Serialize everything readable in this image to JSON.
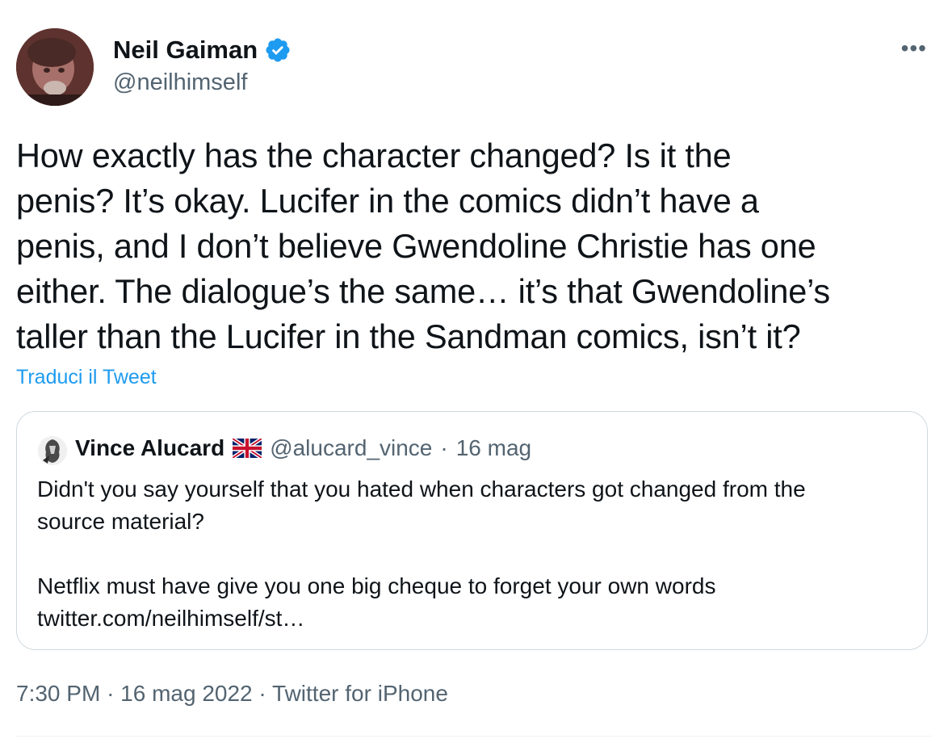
{
  "author": {
    "name": "Neil Gaiman",
    "handle": "@neilhimself",
    "verified_color": "#1d9bf0"
  },
  "more_menu": {
    "label": "•••",
    "icon": "more-horizontal-icon"
  },
  "tweet": {
    "text": "How exactly has the character changed? Is it the\npenis? It’s okay. Lucifer in the comics didn’t have a\npenis, and I don’t believe Gwendoline Christie has one\neither. The dialogue’s the same… it’s that Gwendoline’s\ntaller than the Lucifer in the Sandman comics, isn’t it?",
    "translate_label": "Traduci il Tweet"
  },
  "quoted": {
    "name": "Vince Alucard",
    "flag_icon": "uk-flag-icon",
    "handle": "@alucard_vince",
    "separator": "·",
    "date": "16 mag",
    "text": "Didn't you say yourself that you hated when characters got changed from the\nsource material?\n\nNetflix must have give you one big cheque to forget your own words\ntwitter.com/neilhimself/st…"
  },
  "meta": {
    "time": "7:30 PM",
    "separator": "·",
    "date": "16 mag 2022",
    "source": "Twitter for iPhone"
  },
  "colors": {
    "text": "#0f1419",
    "secondary": "#536471",
    "accent": "#1d9bf0",
    "border": "#cfd9de"
  }
}
